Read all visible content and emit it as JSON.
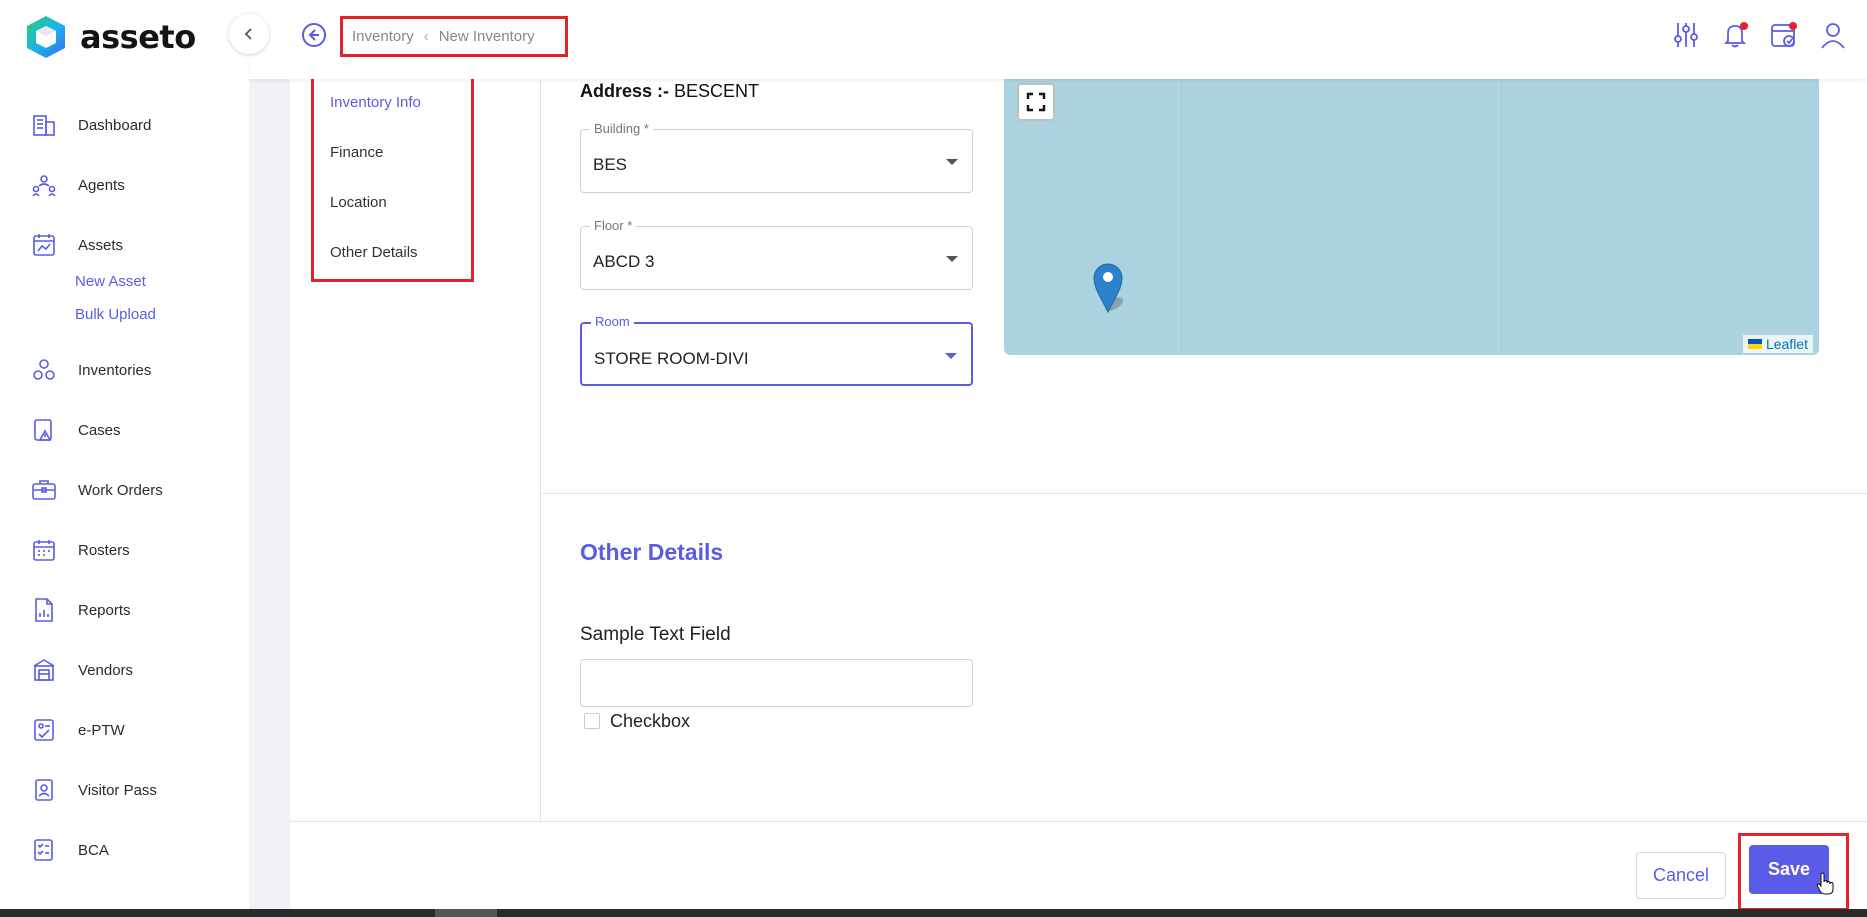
{
  "app": {
    "name": "asseto"
  },
  "breadcrumb": {
    "root": "Inventory",
    "current": "New Inventory"
  },
  "sidebar": {
    "items": [
      {
        "label": "Dashboard",
        "icon": "building-icon"
      },
      {
        "label": "Agents",
        "icon": "agents-icon"
      },
      {
        "label": "Assets",
        "icon": "assets-icon"
      },
      {
        "label": "Inventories",
        "icon": "inventories-icon"
      },
      {
        "label": "Cases",
        "icon": "cases-icon"
      },
      {
        "label": "Work Orders",
        "icon": "briefcase-icon"
      },
      {
        "label": "Rosters",
        "icon": "calendar-icon"
      },
      {
        "label": "Reports",
        "icon": "report-icon"
      },
      {
        "label": "Vendors",
        "icon": "store-icon"
      },
      {
        "label": "e-PTW",
        "icon": "permit-icon"
      },
      {
        "label": "Visitor Pass",
        "icon": "badge-icon"
      },
      {
        "label": "BCA",
        "icon": "checklist-icon"
      }
    ],
    "assets_subitems": [
      "New Asset",
      "Bulk Upload"
    ]
  },
  "subnav": [
    "Inventory Info",
    "Finance",
    "Location",
    "Other Details"
  ],
  "location": {
    "address_label": "Address :-",
    "address_value": "BESCENT",
    "building": {
      "label": "Building *",
      "value": "BES"
    },
    "floor": {
      "label": "Floor *",
      "value": "ABCD 3"
    },
    "room": {
      "label": "Room",
      "value": "STORE ROOM-DIVI"
    }
  },
  "map": {
    "attribution": "Leaflet"
  },
  "other_details": {
    "title": "Other Details",
    "text_field_label": "Sample Text Field",
    "text_field_value": "",
    "checkbox_label": "Checkbox",
    "checkbox_checked": false
  },
  "actions": {
    "cancel": "Cancel",
    "save": "Save"
  },
  "colors": {
    "accent": "#5a5ce8",
    "highlight": "#e3242b",
    "map_water": "#aad3df"
  }
}
